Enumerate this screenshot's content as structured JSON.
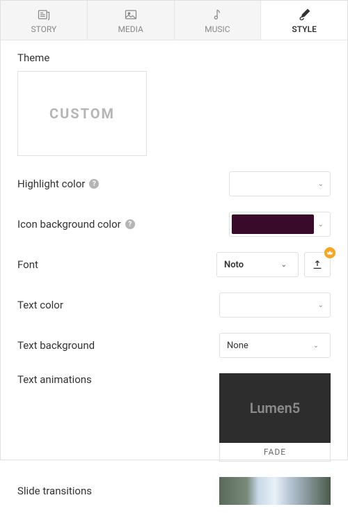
{
  "tabs": {
    "story": "STORY",
    "media": "MEDIA",
    "music": "MUSIC",
    "style": "STYLE"
  },
  "style": {
    "theme_label": "Theme",
    "theme_name": "CUSTOM",
    "highlight_color": {
      "label": "Highlight color",
      "value": "#ec4079"
    },
    "icon_bg_color": {
      "label": "Icon background color",
      "value": "#3a0a2a"
    },
    "font": {
      "label": "Font",
      "value": "Noto"
    },
    "text_color": {
      "label": "Text color",
      "value": "#ffffff"
    },
    "text_background": {
      "label": "Text background",
      "value": "None"
    },
    "text_animations": {
      "label": "Text animations",
      "preview_text": "Lumen5",
      "name": "FADE"
    },
    "slide_transitions": {
      "label": "Slide transitions"
    }
  },
  "glyphs": {
    "help": "?",
    "chev": "⌄"
  }
}
